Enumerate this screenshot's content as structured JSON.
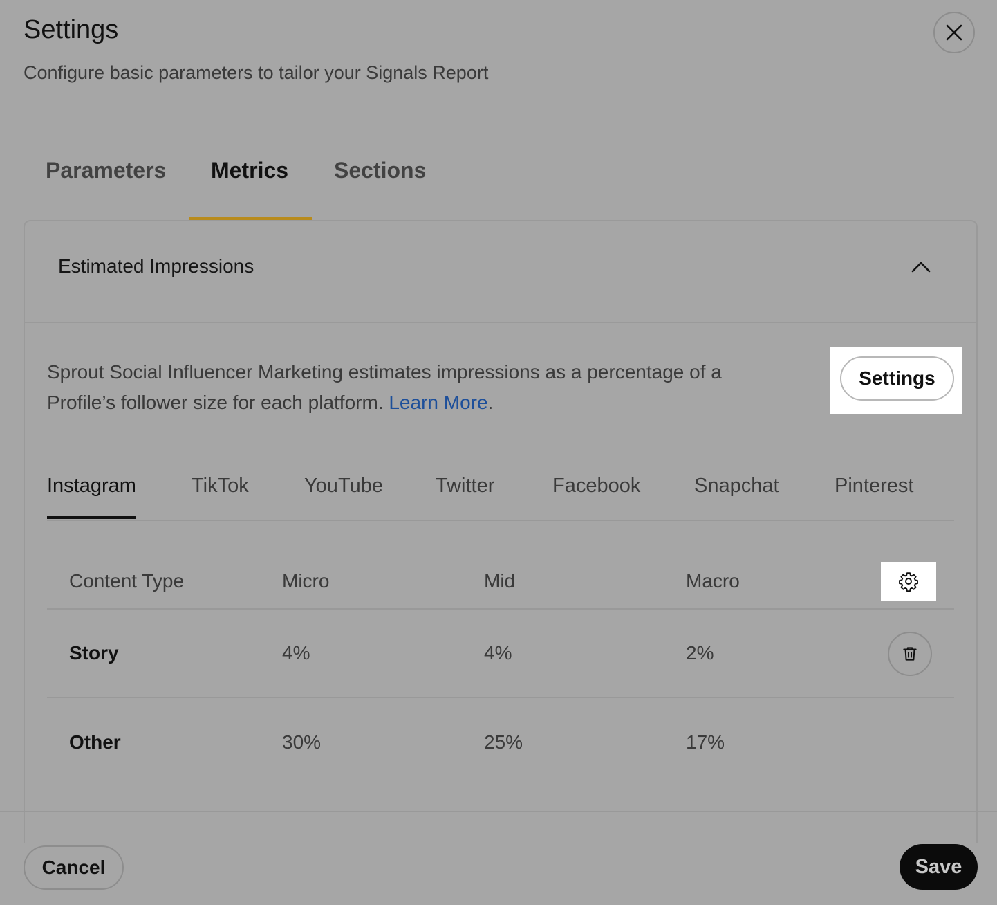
{
  "dialog": {
    "title": "Settings",
    "subtitle": "Configure basic parameters to tailor your Signals Report"
  },
  "tabs": [
    {
      "label": "Parameters",
      "active": false
    },
    {
      "label": "Metrics",
      "active": true
    },
    {
      "label": "Sections",
      "active": false
    }
  ],
  "panel": {
    "title": "Estimated Impressions",
    "description": "Sprout Social Influencer Marketing estimates impressions as a percentage of a Profile’s follower size for each platform.",
    "link_text": "Learn More",
    "link_suffix": ".",
    "settings_button": "Settings"
  },
  "platform_tabs": [
    {
      "label": "Instagram",
      "active": true
    },
    {
      "label": "TikTok",
      "active": false
    },
    {
      "label": "YouTube",
      "active": false
    },
    {
      "label": "Twitter",
      "active": false
    },
    {
      "label": "Facebook",
      "active": false
    },
    {
      "label": "Snapchat",
      "active": false
    },
    {
      "label": "Pinterest",
      "active": false
    }
  ],
  "table": {
    "headers": [
      "Content Type",
      "Micro",
      "Mid",
      "Macro"
    ],
    "rows": [
      {
        "content_type": "Story",
        "micro": "4%",
        "mid": "4%",
        "macro": "2%"
      },
      {
        "content_type": "Other",
        "micro": "30%",
        "mid": "25%",
        "macro": "17%"
      }
    ]
  },
  "footer": {
    "cancel": "Cancel",
    "save": "Save"
  },
  "colors": {
    "overlay_background": "#a6a6a6",
    "active_tab_underline": "#b88b1c",
    "link": "#1d4f9a",
    "save_button": "#0b0b0b"
  },
  "icons": [
    "close-icon",
    "chevron-up-icon",
    "gear-icon",
    "trash-icon"
  ]
}
